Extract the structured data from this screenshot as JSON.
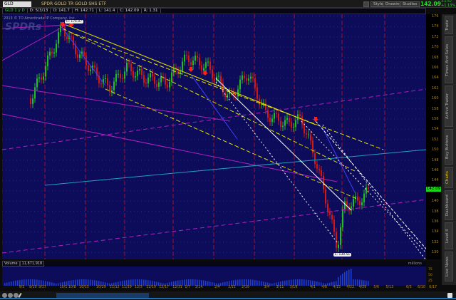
{
  "toolbar": {
    "symbol": "GLD",
    "name": "SPDR GOLD TR GOLD SHS ETF",
    "buttons": [
      "Style",
      "Drawings",
      "Studies"
    ],
    "last": "142.09",
    "change_up": "+1.57",
    "change_dn": "+1.13%"
  },
  "info": {
    "tag": "GLD 1 y D",
    "d": "D: 5/3/13",
    "o": "O: 141.7",
    "h": "H: 142.71",
    "l": "L: 141.4",
    "c": "C: 142.09",
    "r": "R: 1.31"
  },
  "copyright": "2013 © TD Ameritrade IP Company, Inc.",
  "watermark": "SPDRs",
  "annotations": {
    "high": "H: 174.07",
    "low": "L: 130.51"
  },
  "price_axis": [
    "176",
    "174",
    "172",
    "170",
    "168",
    "166",
    "164",
    "162",
    "160",
    "158",
    "156",
    "154",
    "152",
    "150",
    "148",
    "146",
    "144",
    "142",
    "140",
    "138",
    "136",
    "134",
    "132",
    "130"
  ],
  "current_price_tag": "142.09",
  "side_tabs": [
    "Trade",
    "Times And Sales",
    "Active Trader",
    "Buy Buttons",
    "Charts",
    "Dashboard",
    "Level II",
    "Live News"
  ],
  "volume": {
    "label": "Volume",
    "value": "11,871,918",
    "unit": "millions",
    "axis": [
      "75",
      "50",
      "25"
    ]
  },
  "dates": [
    "9/3",
    "9/10",
    "9/17",
    "10/1",
    "10/8",
    "10/15",
    "10/29",
    "11/12",
    "11/19",
    "12/3",
    "12/10",
    "12/17",
    "12/31",
    "1/7",
    "1/14",
    "2/4",
    "2/11",
    "2/19",
    "3/4",
    "3/11",
    "3/18",
    "4/1",
    "4/8",
    "4/15",
    "4/22",
    "4/29",
    "5/6",
    "5/13",
    "6/3",
    "6/10",
    "6/17"
  ],
  "colors": {
    "bg": "#0c0c5a",
    "up": "#1fbf1f",
    "down": "#d01818",
    "trend": "#e0e000",
    "magenta": "#b020c0"
  }
}
